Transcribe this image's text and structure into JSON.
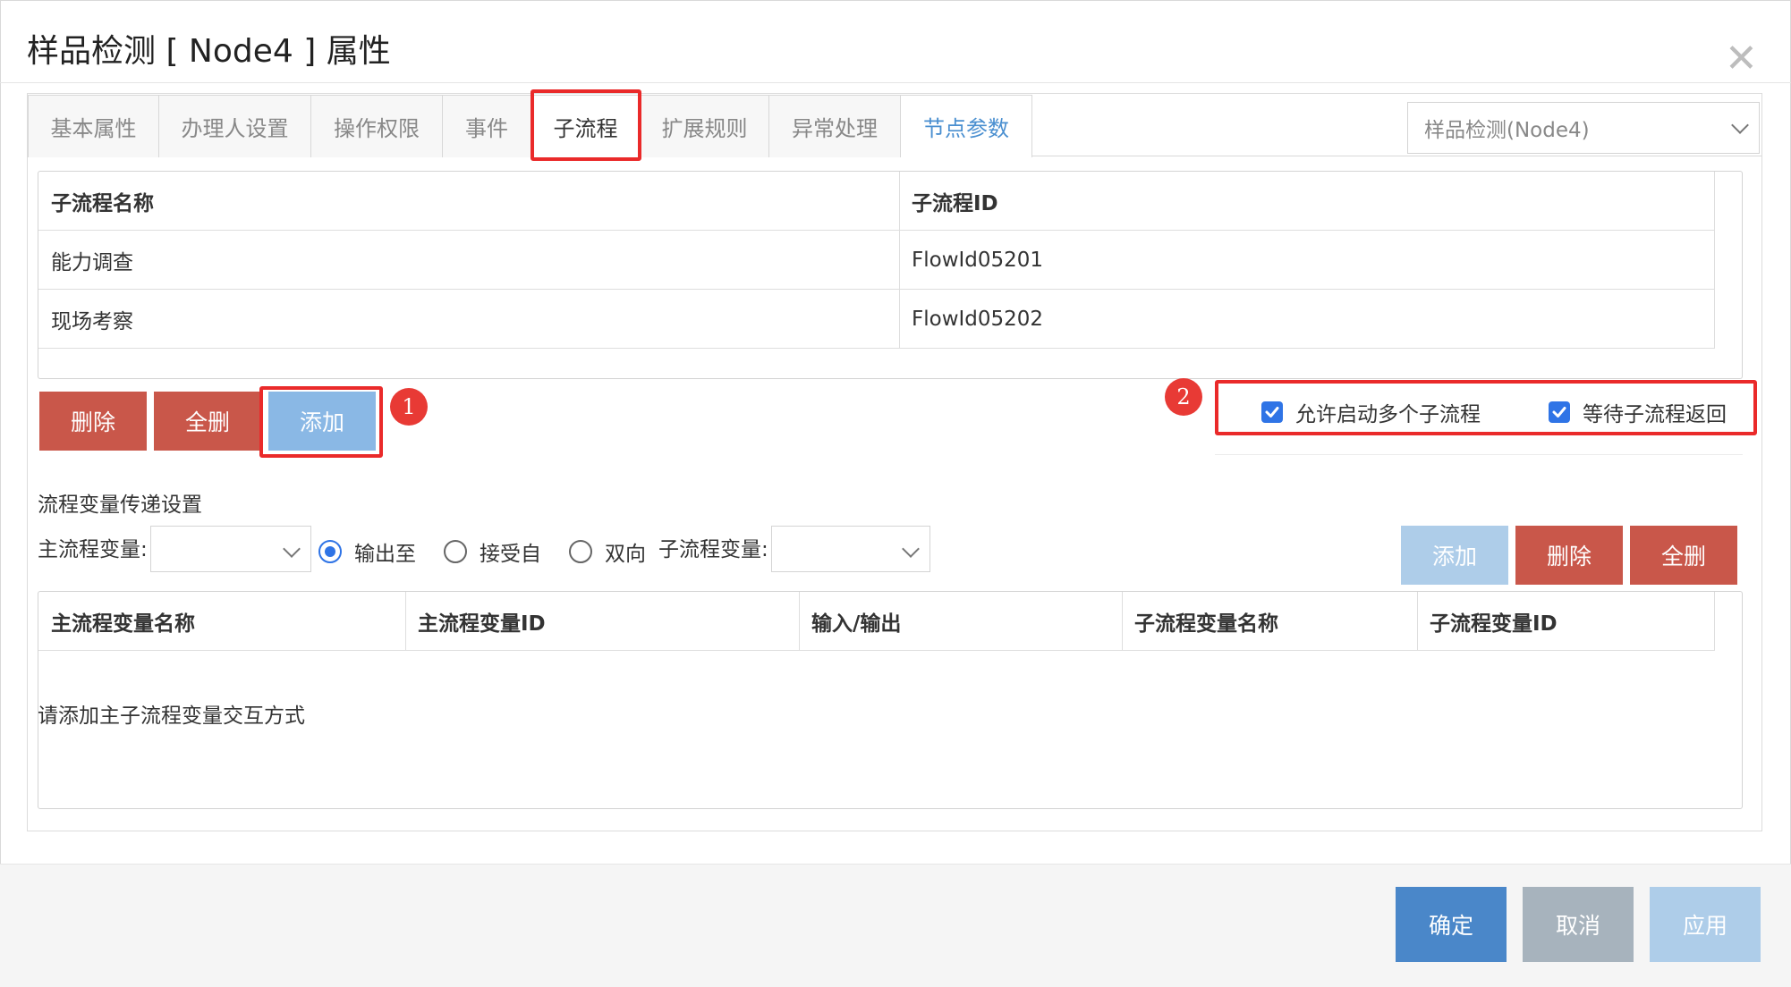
{
  "dialog": {
    "title": "样品检测 [ Node4 ] 属性",
    "close_symbol": "✕"
  },
  "tabs": [
    {
      "label": "基本属性"
    },
    {
      "label": "办理人设置"
    },
    {
      "label": "操作权限"
    },
    {
      "label": "事件"
    },
    {
      "label": "子流程"
    },
    {
      "label": "扩展规则"
    },
    {
      "label": "异常处理"
    },
    {
      "label": "节点参数"
    }
  ],
  "active_tab": "子流程",
  "node_select": {
    "value": "样品检测(Node4)"
  },
  "subflow_grid": {
    "headers": [
      "子流程名称",
      "子流程ID"
    ],
    "rows": [
      {
        "name": "能力调查",
        "id": "FlowId05201"
      },
      {
        "name": "现场考察",
        "id": "FlowId05202"
      }
    ]
  },
  "subflow_actions": {
    "delete": "删除",
    "delete_all": "全删",
    "add": "添加"
  },
  "annotations": {
    "one": "1",
    "two": "2"
  },
  "options": {
    "allow_multiple": {
      "label": "允许启动多个子流程",
      "checked": true
    },
    "wait_return": {
      "label": "等待子流程返回",
      "checked": true
    }
  },
  "variables": {
    "section_title": "流程变量传递设置",
    "main_var_label": "主流程变量:",
    "main_var_value": "",
    "direction_options": [
      {
        "label": "输出至",
        "selected": true
      },
      {
        "label": "接受自",
        "selected": false
      },
      {
        "label": "双向",
        "selected": false
      }
    ],
    "sub_var_label": "子流程变量:",
    "sub_var_value": "",
    "add": "添加",
    "delete": "删除",
    "delete_all": "全删",
    "grid_headers": [
      "主流程变量名称",
      "主流程变量ID",
      "输入/输出",
      "子流程变量名称",
      "子流程变量ID"
    ],
    "empty_text": "请添加主子流程变量交互方式"
  },
  "footer": {
    "ok": "确定",
    "cancel": "取消",
    "apply": "应用"
  },
  "colors": {
    "accent_blue": "#4a87c9",
    "danger_red": "#c9574a",
    "annotation_red": "#ea2a2a",
    "checkbox_blue": "#2f74e6"
  }
}
